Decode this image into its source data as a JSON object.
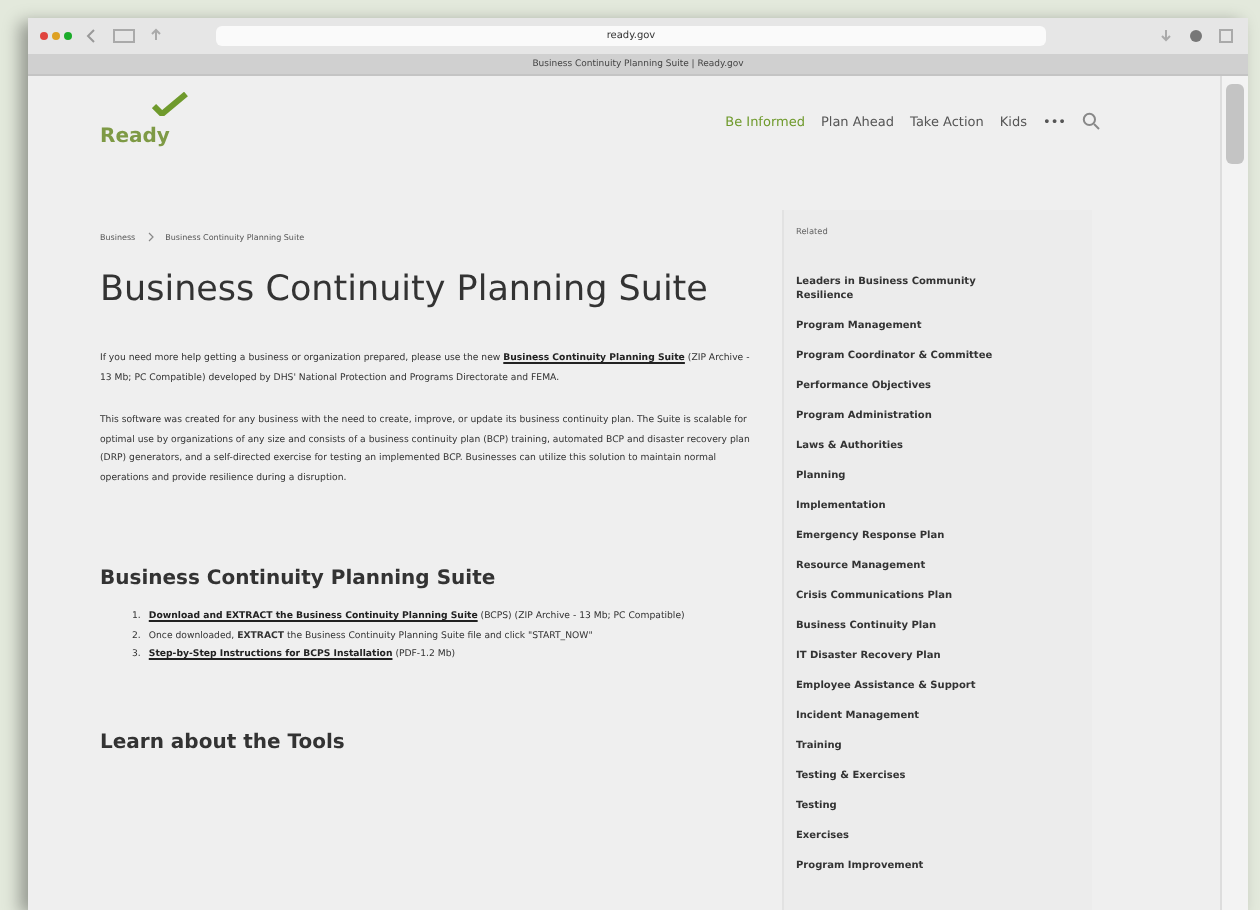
{
  "browser": {
    "url": "ready.gov",
    "tab_title": "Business Continuity Planning Suite | Ready.gov"
  },
  "site": {
    "logo": "Ready",
    "nav": [
      {
        "label": "Be Informed",
        "selected": true
      },
      {
        "label": "Plan Ahead",
        "selected": false
      },
      {
        "label": "Take Action",
        "selected": false
      },
      {
        "label": "Kids",
        "selected": false
      }
    ],
    "more": "•••"
  },
  "breadcrumb": [
    "Business",
    "Business Continuity Planning Suite"
  ],
  "title": "Business Continuity Planning Suite",
  "intro": {
    "before": "If you need more help getting a business or organization prepared, please use the new ",
    "link": "Business Continuity Planning Suite",
    "after": " (ZIP Archive - 13 Mb; PC Compatible) developed by DHS' National Protection and Programs Directorate and FEMA."
  },
  "paragraph": "This software was created for any business with the need to create, improve, or update its business continuity plan. The Suite is scalable for optimal use by organizations of any size and consists of a business continuity plan (BCP) training, automated BCP and disaster recovery plan (DRP) generators, and a self-directed exercise for testing an implemented BCP. Businesses can utilize this solution to maintain normal operations and provide resilience during a disruption.",
  "section": {
    "heading": "Business Continuity Planning Suite",
    "steps": [
      {
        "number": "1.",
        "link": "Download and EXTRACT the Business Continuity Planning Suite",
        "text": " (BCPS) (ZIP Archive - 13 Mb; PC Compatible)"
      },
      {
        "number": "2.",
        "text": "Once downloaded, **EXTRACT** the Business Continuity Planning Suite file and click \"START_NOW\""
      },
      {
        "number": "3.",
        "link": "Step-by-Step Instructions for BCPS Installation",
        "text": " (PDF-1.2 Mb)"
      }
    ]
  },
  "section2": {
    "heading": "Learn about the Tools"
  },
  "related": {
    "title": "Related",
    "items": [
      "Leaders in Business Community Resilience",
      "Program Management",
      "Program Coordinator & Committee",
      "Performance Objectives",
      "Program Administration",
      "Laws & Authorities",
      "Planning",
      "Implementation",
      "Emergency Response Plan",
      "Resource Management",
      "Crisis Communications Plan",
      "Business Continuity Plan",
      "IT Disaster Recovery Plan",
      "Employee Assistance & Support",
      "Incident Management",
      "Training",
      "Testing & Exercises",
      "Testing",
      "Exercises",
      "Program Improvement"
    ]
  }
}
